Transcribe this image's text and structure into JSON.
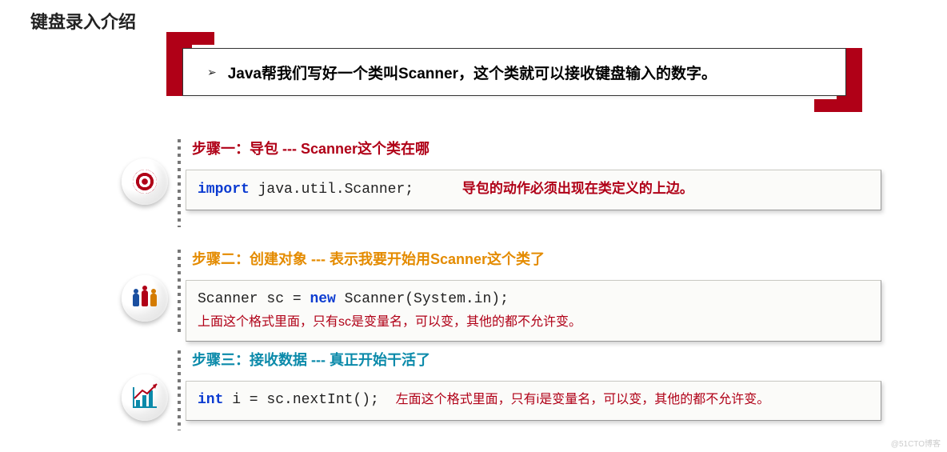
{
  "title": "键盘录入介绍",
  "callout": {
    "arrow": "➢",
    "text": "Java帮我们写好一个类叫Scanner，这个类就可以接收键盘输入的数字。"
  },
  "steps": {
    "s1": {
      "heading": "步骤一：导包  ---  Scanner这个类在哪",
      "code_kw": "import",
      "code_rest": " java.util.Scanner;",
      "note": "导包的动作必须出现在类定义的上边。"
    },
    "s2": {
      "heading": "步骤二：创建对象 --- 表示我要开始用Scanner这个类了",
      "code_pre": "Scanner sc = ",
      "code_kw": "new",
      "code_post": " Scanner(System.in);",
      "note": "上面这个格式里面，只有sc是变量名，可以变，其他的都不允许变。"
    },
    "s3": {
      "heading": "步骤三：接收数据 --- 真正开始干活了",
      "code_kw": "int",
      "code_post": " i = sc.nextInt();",
      "note": "左面这个格式里面，只有i是变量名，可以变，其他的都不允许变。"
    }
  },
  "watermark": "@51CTO博客"
}
